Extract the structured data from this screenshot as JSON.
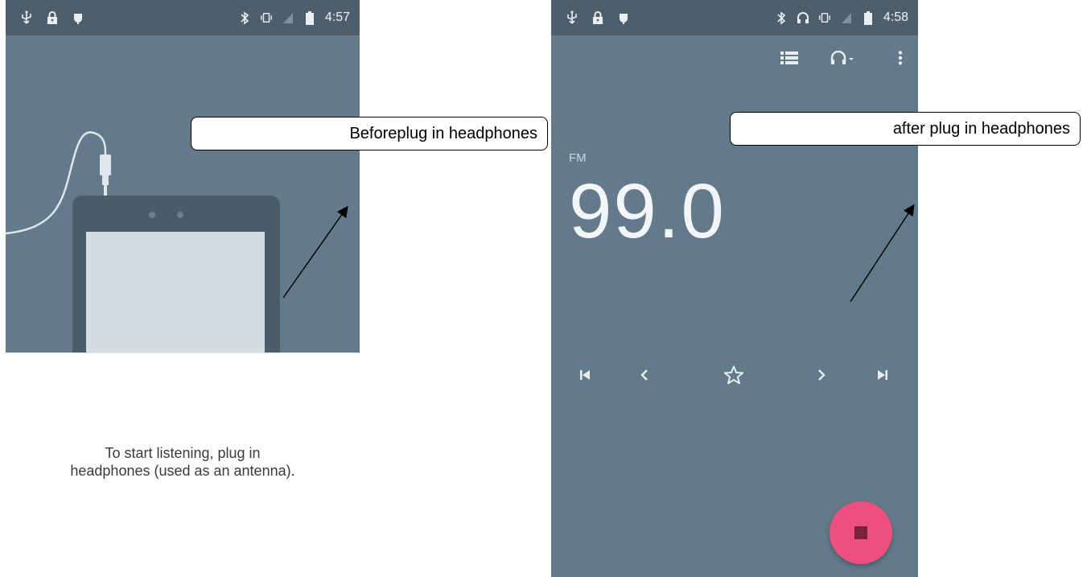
{
  "left_screen": {
    "status_bar": {
      "time": "4:57",
      "left_icons": [
        "usb-icon",
        "lock-icon",
        "debug-icon"
      ],
      "right_icons": [
        "bluetooth-icon",
        "vibrate-icon",
        "no-signal-icon",
        "battery-icon"
      ]
    },
    "message_line1": "To start listening, plug in",
    "message_line2": "headphones (used as an antenna)."
  },
  "right_screen": {
    "status_bar": {
      "time": "4:58",
      "left_icons": [
        "usb-icon",
        "lock-icon",
        "debug-icon"
      ],
      "right_icons": [
        "bluetooth-icon",
        "headphones-icon",
        "vibrate-icon",
        "no-signal-icon",
        "battery-icon"
      ]
    },
    "toolbar_icons": [
      "station-list-icon",
      "headphones-output-icon",
      "more-options-icon"
    ],
    "band": "FM",
    "frequency": "99.0",
    "controls": [
      "skip-previous-icon",
      "seek-back-icon",
      "favorite-star-icon",
      "seek-forward-icon",
      "skip-next-icon"
    ],
    "fab_icon": "stop-icon"
  },
  "callouts": {
    "before": "Beforeplug in headphones",
    "after": "after plug in headphones"
  },
  "colors": {
    "status_bar": "#4e5f6b",
    "screen_background": "#627a89",
    "tablet_body": "#4a5c67",
    "tablet_screen": "#d3dde2",
    "fab": "#ef4f7e"
  }
}
